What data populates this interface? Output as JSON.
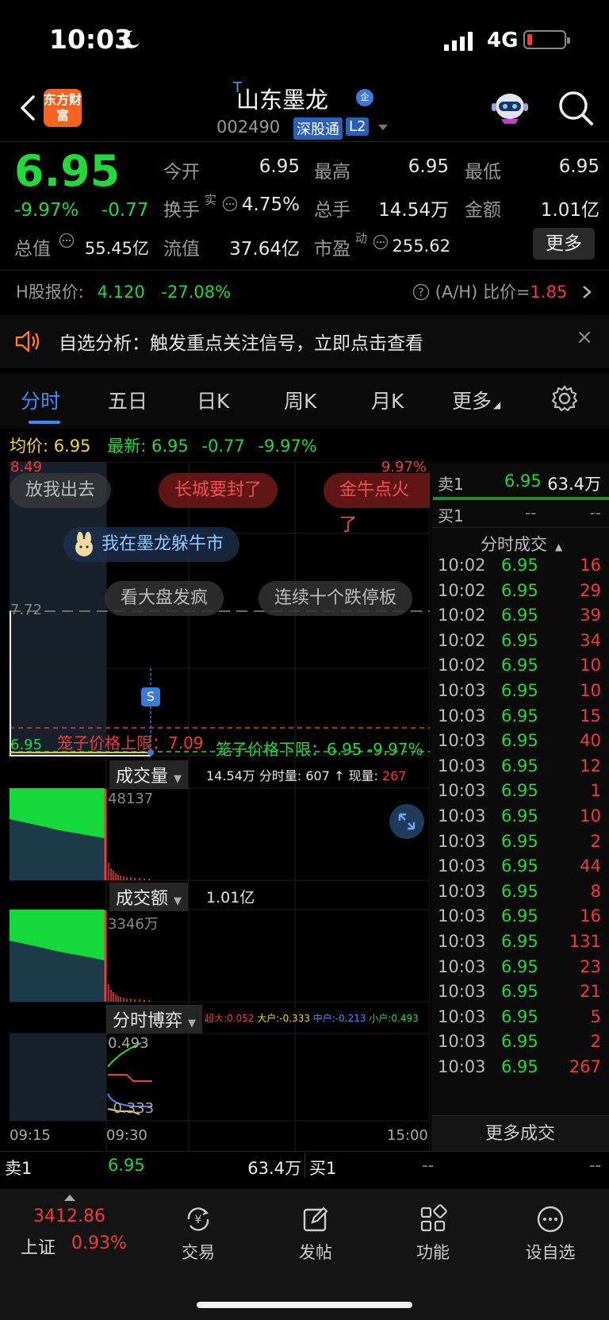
{
  "status_bar": {
    "time": "10:03",
    "network": "4G"
  },
  "header": {
    "brand": "东方财富",
    "t_mark": "T",
    "stock_name": "山东墨龙",
    "qi_badge": "企",
    "stock_code": "002490",
    "tag_connect": "深股通",
    "tag_level": "L2"
  },
  "quote": {
    "price": "6.95",
    "change_pct": "-9.97%",
    "change": "-0.77",
    "open_label": "今开",
    "open": "6.95",
    "high_label": "最高",
    "high": "6.95",
    "low_label": "最低",
    "low": "6.95",
    "turnover_label": "换手",
    "turnover_sup": "实",
    "turnover": "4.75%",
    "volume_label": "总手",
    "volume": "14.54万",
    "amount_label": "金额",
    "amount": "1.01亿",
    "mktcap_label": "总值",
    "mktcap": "55.45亿",
    "float_label": "流值",
    "float": "37.64亿",
    "pe_label": "市盈",
    "pe_sup": "动",
    "pe": "255.62",
    "more_button": "更多"
  },
  "h_share": {
    "label": "H股报价:",
    "price": "4.120",
    "pct": "-27.08%",
    "ratio_label": "(A/H) 比价=",
    "ratio": "1.85"
  },
  "notice": {
    "text": "自选分析：触发重点关注信号，立即点击查看"
  },
  "tabs": [
    "分时",
    "五日",
    "日K",
    "周K",
    "月K",
    "更多"
  ],
  "summary": {
    "avg_label": "均价:",
    "avg": "6.95",
    "latest_label": "最新:",
    "latest": "6.95",
    "latest_chg": "-0.77",
    "latest_pct": "-9.97%"
  },
  "chart": {
    "top_price": "8.49",
    "top_pct": "9.97%",
    "prev_close": "7.72",
    "bottom_price": "6.95",
    "upper_limit_label": "笼子价格上限：7.09",
    "lower_limit_label": "笼子价格下限：6.95  -9.97%",
    "s_marker": "S",
    "bullets": [
      "放我出去",
      "长城要封了",
      "金牛点火了",
      "我在墨龙躲牛市",
      "看大盘发疯",
      "连续十个跌停板"
    ],
    "volume_label": "成交量",
    "volume_info": "14.54万  分时量: 607 ↑ 现量: ",
    "volume_now": "267",
    "volume_max": "48137",
    "amount_label": "成交额",
    "amount_info": "1.01亿",
    "amount_max": "3346万",
    "game_label": "分时博弈",
    "game_super": "超大:0.052",
    "game_large": "大户:-0.333",
    "game_mid": "中户:-0.213",
    "game_small": "小户:0.493",
    "game_top": "0.493",
    "game_bottom": "-0.333",
    "time_start": "09:15",
    "time_open": "09:30",
    "time_end": "15:00"
  },
  "book": {
    "sell1_label": "卖1",
    "sell1_price": "6.95",
    "sell1_vol": "63.4万",
    "buy1_label": "买1",
    "buy1_price": "--",
    "buy1_vol": "--",
    "ticks_title": "分时成交",
    "ticks": [
      {
        "t": "10:02",
        "p": "6.95",
        "v": "16"
      },
      {
        "t": "10:02",
        "p": "6.95",
        "v": "29"
      },
      {
        "t": "10:02",
        "p": "6.95",
        "v": "39"
      },
      {
        "t": "10:02",
        "p": "6.95",
        "v": "34"
      },
      {
        "t": "10:02",
        "p": "6.95",
        "v": "10"
      },
      {
        "t": "10:03",
        "p": "6.95",
        "v": "10"
      },
      {
        "t": "10:03",
        "p": "6.95",
        "v": "15"
      },
      {
        "t": "10:03",
        "p": "6.95",
        "v": "40"
      },
      {
        "t": "10:03",
        "p": "6.95",
        "v": "12"
      },
      {
        "t": "10:03",
        "p": "6.95",
        "v": "1"
      },
      {
        "t": "10:03",
        "p": "6.95",
        "v": "10"
      },
      {
        "t": "10:03",
        "p": "6.95",
        "v": "2"
      },
      {
        "t": "10:03",
        "p": "6.95",
        "v": "44"
      },
      {
        "t": "10:03",
        "p": "6.95",
        "v": "8"
      },
      {
        "t": "10:03",
        "p": "6.95",
        "v": "16"
      },
      {
        "t": "10:03",
        "p": "6.95",
        "v": "131"
      },
      {
        "t": "10:03",
        "p": "6.95",
        "v": "23"
      },
      {
        "t": "10:03",
        "p": "6.95",
        "v": "21"
      },
      {
        "t": "10:03",
        "p": "6.95",
        "v": "5"
      },
      {
        "t": "10:03",
        "p": "6.95",
        "v": "2"
      },
      {
        "t": "10:03",
        "p": "6.95",
        "v": "267"
      }
    ],
    "more_ticks": "更多成交"
  },
  "bottom_bar": {
    "sell_label": "卖1",
    "sell_price": "6.95",
    "sell_vol": "63.4万",
    "buy_label": "买1",
    "buy_price": "--",
    "buy_vol": "--"
  },
  "nav": {
    "index_value": "3412.86",
    "index_name": "上证",
    "index_pct": "0.93%",
    "trade": "交易",
    "post": "发帖",
    "functions": "功能",
    "watchlist": "设自选"
  },
  "colors": {
    "up": "#f23a3a",
    "down": "#22d83a",
    "accent": "#3b8cff",
    "brand": "#f6631f"
  }
}
